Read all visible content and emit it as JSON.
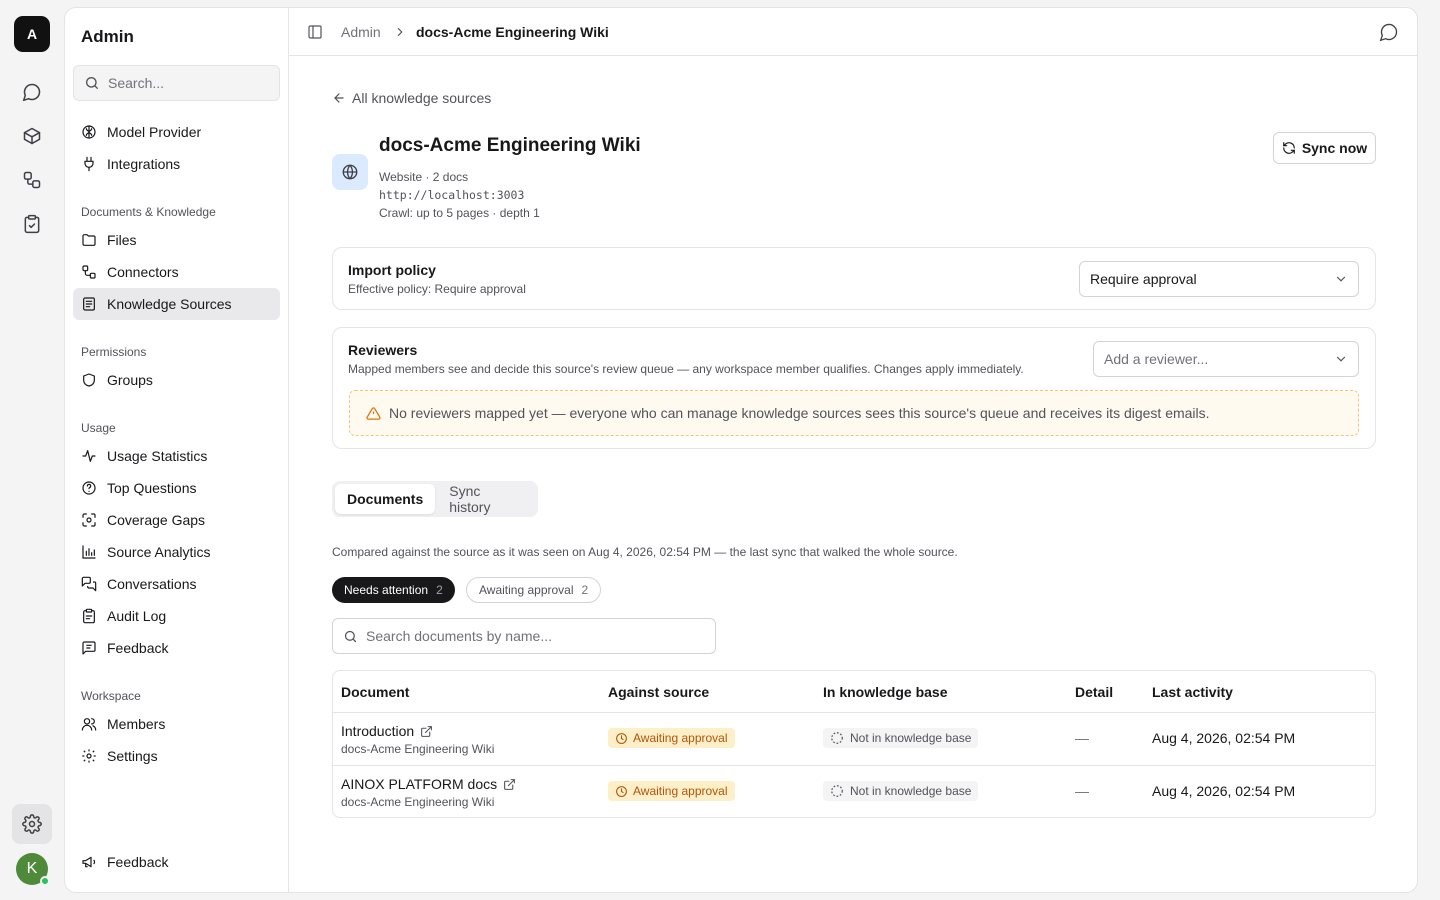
{
  "rail": {
    "logo_letter": "A",
    "avatar_letter": "K"
  },
  "sidebar": {
    "title": "Admin",
    "search_placeholder": "Search...",
    "top_items": [
      {
        "label": "Model Provider",
        "icon": "brain-icon"
      },
      {
        "label": "Integrations",
        "icon": "plug-icon"
      }
    ],
    "groups": [
      {
        "label": "Documents & Knowledge",
        "items": [
          {
            "label": "Files",
            "icon": "folder-icon"
          },
          {
            "label": "Connectors",
            "icon": "connector-icon"
          },
          {
            "label": "Knowledge Sources",
            "icon": "book-icon",
            "active": true
          }
        ]
      },
      {
        "label": "Permissions",
        "items": [
          {
            "label": "Groups",
            "icon": "shield-icon"
          }
        ]
      },
      {
        "label": "Usage",
        "items": [
          {
            "label": "Usage Statistics",
            "icon": "activity-icon"
          },
          {
            "label": "Top Questions",
            "icon": "question-icon"
          },
          {
            "label": "Coverage Gaps",
            "icon": "scan-icon"
          },
          {
            "label": "Source Analytics",
            "icon": "bar-chart-icon"
          },
          {
            "label": "Conversations",
            "icon": "messages-icon"
          },
          {
            "label": "Audit Log",
            "icon": "clipboard-icon"
          },
          {
            "label": "Feedback",
            "icon": "message-square-icon"
          }
        ]
      },
      {
        "label": "Workspace",
        "items": [
          {
            "label": "Members",
            "icon": "users-icon"
          },
          {
            "label": "Settings",
            "icon": "gear-icon"
          }
        ]
      }
    ],
    "footer_feedback": "Feedback"
  },
  "breadcrumb": {
    "parent": "Admin",
    "current": "docs-Acme Engineering Wiki"
  },
  "back_link": "All knowledge sources",
  "source": {
    "title": "docs-Acme Engineering Wiki",
    "meta": "Website · 2 docs",
    "url": "http://localhost:3003",
    "crawl": "Crawl: up to 5 pages · depth 1",
    "sync_label": "Sync now"
  },
  "import_policy": {
    "title": "Import policy",
    "subtitle": "Effective policy: Require approval",
    "selected": "Require approval"
  },
  "reviewers": {
    "title": "Reviewers",
    "subtitle": "Mapped members see and decide this source's review queue — any workspace member qualifies. Changes apply immediately.",
    "placeholder": "Add a reviewer...",
    "warning": "No reviewers mapped yet — everyone who can manage knowledge sources sees this source's queue and receives its digest emails."
  },
  "tabs": [
    {
      "label": "Documents",
      "active": true
    },
    {
      "label": "Sync history",
      "active": false
    }
  ],
  "compare_note": "Compared against the source as it was seen on Aug 4, 2026, 02:54 PM — the last sync that walked the whole source.",
  "filters": [
    {
      "label": "Needs attention",
      "count": "2",
      "active": true
    },
    {
      "label": "Awaiting approval",
      "count": "2",
      "active": false
    }
  ],
  "doc_search_placeholder": "Search documents by name...",
  "table": {
    "headers": [
      "Document",
      "Against source",
      "In knowledge base",
      "Detail",
      "Last activity"
    ],
    "rows": [
      {
        "name": "Introduction",
        "source": "docs-Acme Engineering Wiki",
        "against": "Awaiting approval",
        "kb": "Not in knowledge base",
        "detail": "—",
        "last": "Aug 4, 2026, 02:54 PM"
      },
      {
        "name": "AINOX PLATFORM docs",
        "source": "docs-Acme Engineering Wiki",
        "against": "Awaiting approval",
        "kb": "Not in knowledge base",
        "detail": "—",
        "last": "Aug 4, 2026, 02:54 PM"
      }
    ]
  },
  "colors": {
    "accent_dark": "#18181b",
    "warning_amber": "#d97706",
    "badge_amber_bg": "#fdf0c8",
    "avatar_green": "#4f8a3a"
  }
}
